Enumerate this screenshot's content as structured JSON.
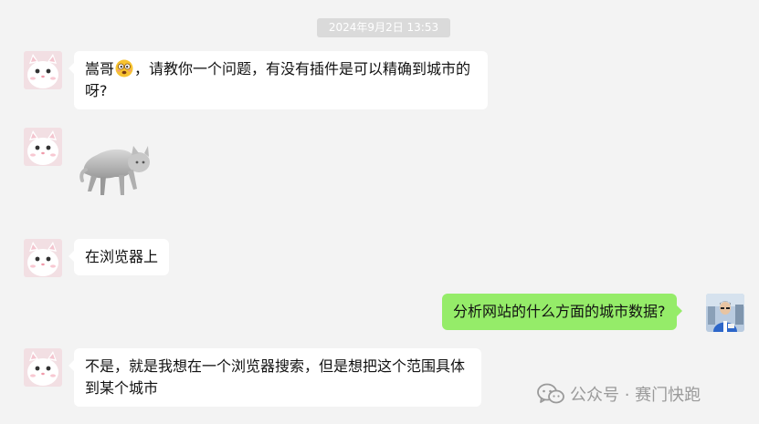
{
  "chat": {
    "timestamp": "2024年9月2日 13:53",
    "messages": [
      {
        "sender": "other",
        "text_before_emoji": "嵩哥",
        "emoji": "dizzy-face-emoji",
        "text_after_emoji": "，请教你一个问题，有没有插件是可以精确到城市的呀?"
      },
      {
        "sender": "other",
        "type": "sticker",
        "sticker": "walking-cat-sticker"
      },
      {
        "sender": "other",
        "text": "在浏览器上"
      },
      {
        "sender": "self",
        "text": "分析网站的什么方面的城市数据?"
      },
      {
        "sender": "other",
        "text": "不是，就是我想在一个浏览器搜索，但是想把这个范围具体到某个城市"
      }
    ]
  },
  "watermark": {
    "icon": "wechat-icon",
    "text": "公众号 · 赛门快跑"
  },
  "colors": {
    "background": "#f3f3f3",
    "incoming_bubble": "#ffffff",
    "outgoing_bubble": "#95ec69",
    "timestamp_bg": "#dadada"
  }
}
